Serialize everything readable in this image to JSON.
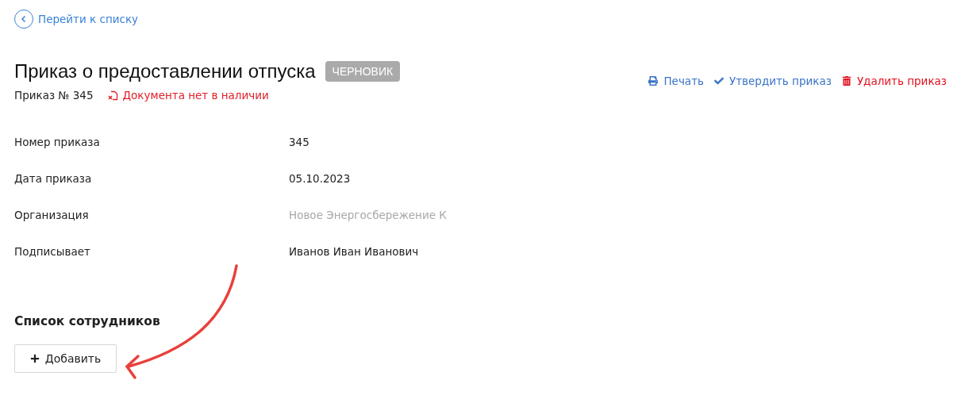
{
  "back_link": {
    "label": "Перейти к списку"
  },
  "header": {
    "title": "Приказ о предоставлении отпуска",
    "status": "ЧЕРНОВИК",
    "number": "Приказ № 345",
    "document_notice": "Документа нет в наличии"
  },
  "actions": [
    {
      "kind": "print",
      "label": "Печать"
    },
    {
      "kind": "approve",
      "label": "Утвердить приказ"
    },
    {
      "kind": "delete",
      "label": "Удалить приказ"
    }
  ],
  "fields": [
    {
      "label": "Номер приказа",
      "value": "345",
      "muted": false
    },
    {
      "label": "Дата приказа",
      "value": "05.10.2023",
      "muted": false
    },
    {
      "label": "Организация",
      "value": "Новое Энергосбережение К",
      "muted": true
    },
    {
      "label": "Подписывает",
      "value": "Иванов Иван Иванович",
      "muted": false
    }
  ],
  "employees": {
    "title": "Список сотрудников",
    "add_button": "Добавить"
  },
  "annotation": {
    "kind": "arrow"
  }
}
